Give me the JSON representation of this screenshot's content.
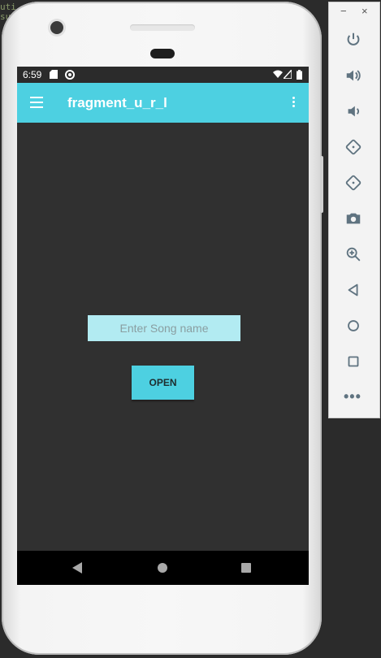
{
  "ide": {
    "code_fragment_1": "uti",
    "code_fragment_2": "sut"
  },
  "status_bar": {
    "time": "6:59"
  },
  "app_bar": {
    "title": "fragment_u_r_l"
  },
  "form": {
    "song_input_placeholder": "Enter Song name",
    "open_button_label": "OPEN"
  },
  "colors": {
    "accent": "#4dd0e1",
    "input_bg": "#b2ebf2",
    "screen_bg": "#303030"
  },
  "emulator_toolbar": {
    "minimize": "−",
    "close": "×",
    "more": "•••",
    "buttons": [
      "power-icon",
      "volume-up-icon",
      "volume-down-icon",
      "rotate-left-icon",
      "rotate-right-icon",
      "camera-icon",
      "zoom-icon",
      "back-icon",
      "home-icon",
      "overview-icon"
    ]
  }
}
